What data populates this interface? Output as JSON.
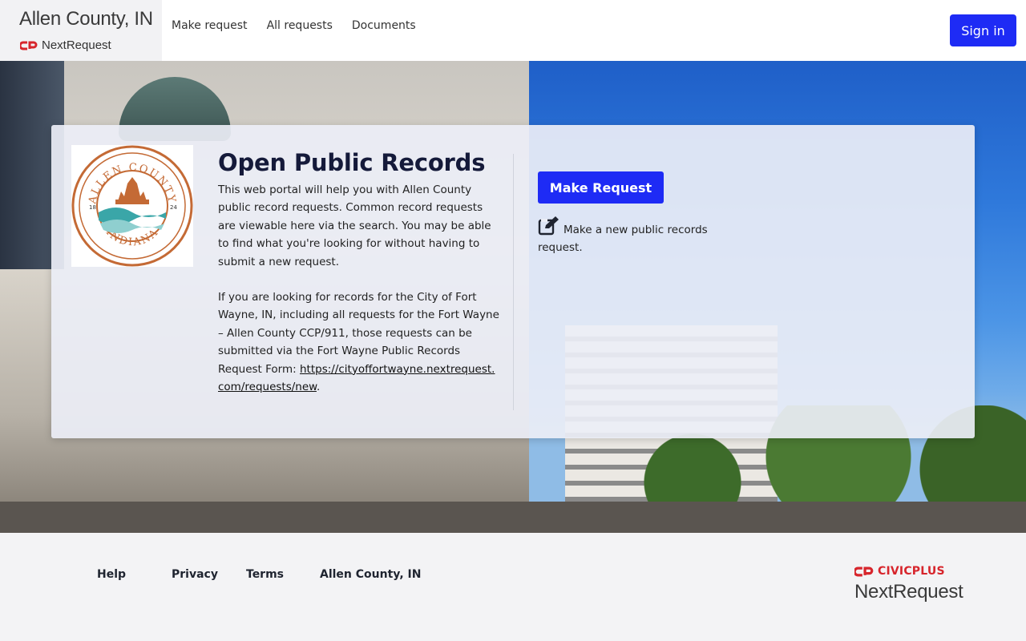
{
  "header": {
    "county": "Allen County, IN",
    "product": "NextRequest",
    "nav": [
      {
        "label": "Make request"
      },
      {
        "label": "All requests"
      },
      {
        "label": "Documents"
      }
    ],
    "signin_label": "Sign in"
  },
  "hero": {
    "title": "Open Public Records",
    "paragraph1": "This web portal will help you with Allen County public record requests. Common record requests are viewable here via the search. You may be able to find what you're looking for without having to submit a new request.",
    "paragraph2": "If you are looking for records for the City of Fort Wayne, IN, including all requests for the Fort Wayne – Allen County CCP/911, those requests can be submitted via the Fort Wayne Public Records Request Form:",
    "link": "https://cityoffortwayne.nextrequest.com/requests/new",
    "link_suffix": ".",
    "make_request_label": "Make Request",
    "make_request_desc": "Make a new public records request.",
    "seal": {
      "top_text": "ALLEN COUNTY",
      "bottom_text": "INDIANA",
      "year_left": "18",
      "year_right": "24"
    }
  },
  "footer": {
    "links": [
      {
        "label": "Help"
      },
      {
        "label": "Privacy"
      },
      {
        "label": "Terms"
      },
      {
        "label": "Allen County, IN"
      }
    ],
    "civic_label": "CIVICPLUS",
    "product_label": "NextRequest"
  },
  "colors": {
    "primary": "#1e2bf5",
    "brand_red": "#d7252c",
    "seal_orange": "#c46a35",
    "seal_teal": "#3aa6a8"
  }
}
